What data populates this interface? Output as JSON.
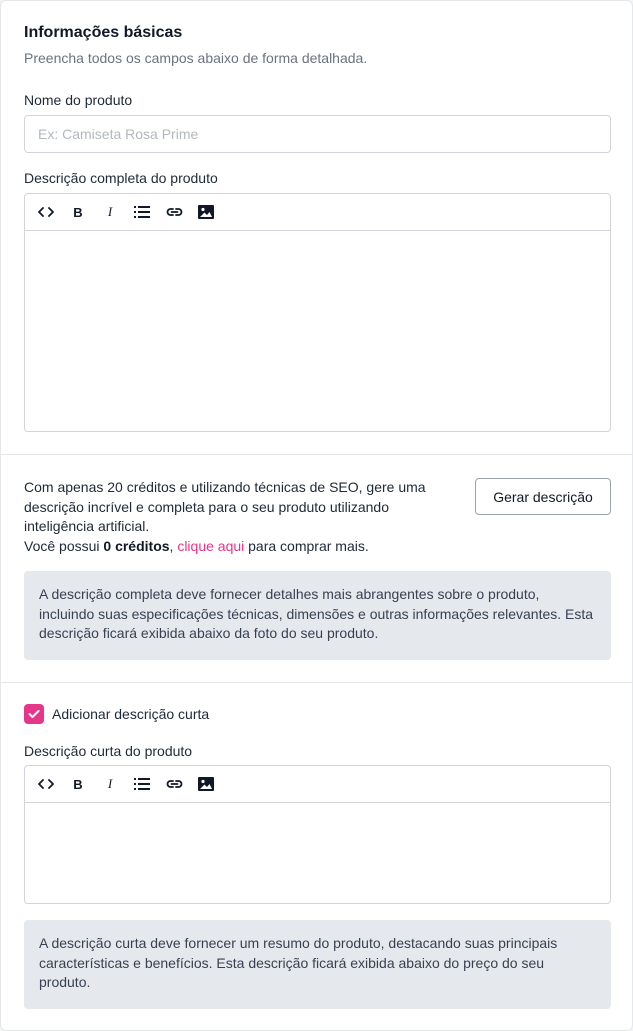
{
  "basic_info": {
    "title": "Informações básicas",
    "subtitle": "Preencha todos os campos abaixo de forma detalhada."
  },
  "product_name": {
    "label": "Nome do produto",
    "value": "",
    "placeholder": "Ex: Camiseta Rosa Prime"
  },
  "full_description": {
    "label": "Descrição completa do produto",
    "toolbar": [
      "code-icon",
      "bold-icon",
      "italic-icon",
      "list-icon",
      "link-icon",
      "image-icon"
    ],
    "toolbar_bold": "B",
    "toolbar_italic": "I",
    "value": ""
  },
  "ai_generate": {
    "text_line": "Com apenas 20 créditos e utilizando técnicas de SEO, gere uma descrição incrível e completa para o seu produto utilizando inteligência artificial.",
    "credits_prefix": "Você possui ",
    "credits_value": "0 créditos",
    "credits_separator": ", ",
    "link_label": "clique aqui",
    "credits_suffix": " para comprar mais.",
    "button_label": "Gerar descrição"
  },
  "full_description_info": "A descrição completa deve fornecer detalhes mais abrangentes sobre o produto, incluindo suas especificações técnicas, dimensões e outras informações relevantes. Esta descrição ficará exibida abaixo da foto do seu produto.",
  "short_description": {
    "checkbox_label": "Adicionar descrição curta",
    "checked": true,
    "label": "Descrição curta do produto",
    "value": "",
    "info": "A descrição curta deve fornecer um resumo do produto, destacando suas principais características e benefícios. Esta descrição ficará exibida abaixo do preço do seu produto."
  },
  "colors": {
    "accent": "#e6368a",
    "info_background": "#e5e9ee",
    "border": "#d1d5db"
  }
}
